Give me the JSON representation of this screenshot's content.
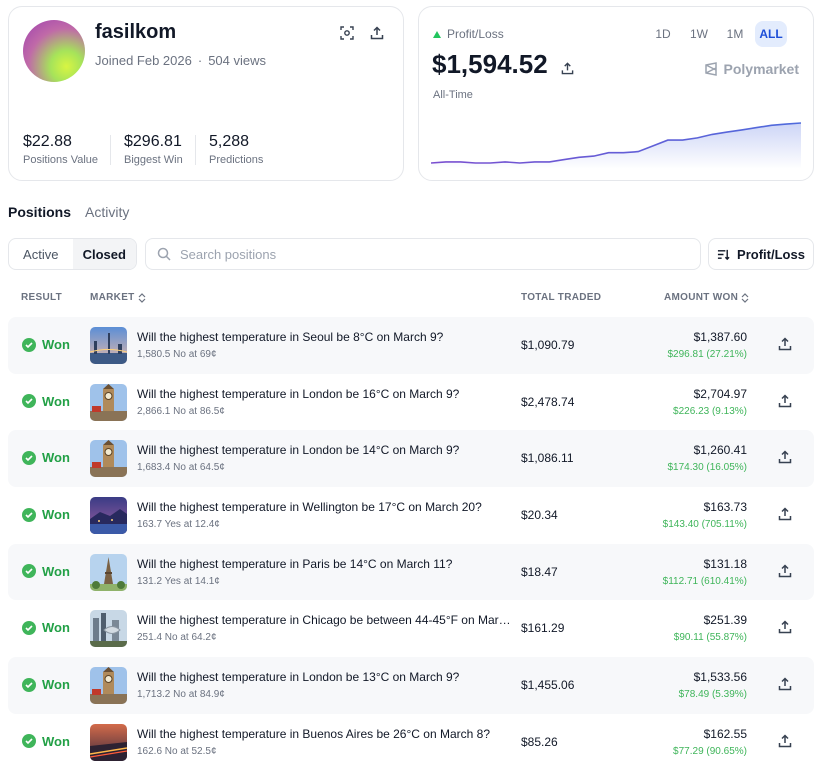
{
  "profile": {
    "username": "fasilkom",
    "joined": "Joined Feb 2026",
    "views": "504 views",
    "stats": [
      {
        "value": "$22.88",
        "label": "Positions Value"
      },
      {
        "value": "$296.81",
        "label": "Biggest Win"
      },
      {
        "value": "5,288",
        "label": "Predictions"
      }
    ]
  },
  "pnl": {
    "label": "Profit/Loss",
    "value": "$1,594.52",
    "period": "All-Time",
    "ranges": [
      "1D",
      "1W",
      "1M",
      "ALL"
    ],
    "active_range": "ALL",
    "brand": "Polymarket",
    "line_color": "#4f6bdc",
    "series": [
      0,
      1,
      1,
      0,
      0,
      1,
      0,
      1,
      1,
      3,
      5,
      6,
      9,
      9,
      10,
      15,
      20,
      20,
      22,
      25,
      27,
      29,
      31,
      33,
      34,
      35
    ]
  },
  "tabs": {
    "positions": "Positions",
    "activity": "Activity"
  },
  "filters": {
    "active": "Active",
    "closed": "Closed",
    "search_placeholder": "Search positions",
    "sort_label": "Profit/Loss"
  },
  "table": {
    "headers": {
      "result": "RESULT",
      "market": "MARKET",
      "total_traded": "TOTAL TRADED",
      "amount_won": "AMOUNT WON"
    },
    "rows": [
      {
        "result": "Won",
        "question": "Will the highest temperature in Seoul be 8°C on March 9?",
        "sub": "1,580.5 No at 69¢",
        "total": "$1,090.79",
        "won": "$1,387.60",
        "profit": "$296.81 (27.21%)",
        "thumb": "seoul"
      },
      {
        "result": "Won",
        "question": "Will the highest temperature in London be 16°C on March 9?",
        "sub": "2,866.1 No at 86.5¢",
        "total": "$2,478.74",
        "won": "$2,704.97",
        "profit": "$226.23 (9.13%)",
        "thumb": "london"
      },
      {
        "result": "Won",
        "question": "Will the highest temperature in London be 14°C on March 9?",
        "sub": "1,683.4 No at 64.5¢",
        "total": "$1,086.11",
        "won": "$1,260.41",
        "profit": "$174.30 (16.05%)",
        "thumb": "london"
      },
      {
        "result": "Won",
        "question": "Will the highest temperature in Wellington be 17°C on March 20?",
        "sub": "163.7 Yes at 12.4¢",
        "total": "$20.34",
        "won": "$163.73",
        "profit": "$143.40 (705.11%)",
        "thumb": "wellington"
      },
      {
        "result": "Won",
        "question": "Will the highest temperature in Paris be 14°C on March 11?",
        "sub": "131.2 Yes at 14.1¢",
        "total": "$18.47",
        "won": "$131.18",
        "profit": "$112.71 (610.41%)",
        "thumb": "paris"
      },
      {
        "result": "Won",
        "question": "Will the highest temperature in Chicago be between 44-45°F on Marc...",
        "sub": "251.4 No at 64.2¢",
        "total": "$161.29",
        "won": "$251.39",
        "profit": "$90.11 (55.87%)",
        "thumb": "chicago"
      },
      {
        "result": "Won",
        "question": "Will the highest temperature in London be 13°C on March 9?",
        "sub": "1,713.2 No at 84.9¢",
        "total": "$1,455.06",
        "won": "$1,533.56",
        "profit": "$78.49 (5.39%)",
        "thumb": "london"
      },
      {
        "result": "Won",
        "question": "Will the highest temperature in Buenos Aires be 26°C on March 8?",
        "sub": "162.6 No at 52.5¢",
        "total": "$85.26",
        "won": "$162.55",
        "profit": "$77.29 (90.65%)",
        "thumb": "buenosaires"
      }
    ]
  }
}
